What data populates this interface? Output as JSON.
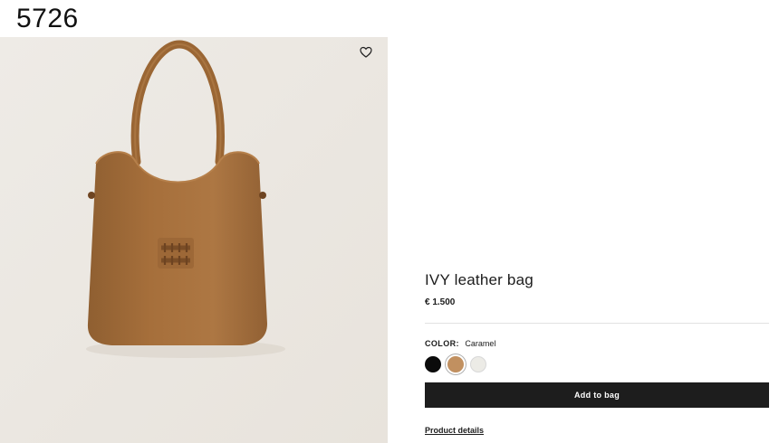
{
  "page_number": "5726",
  "image": {
    "background": "#ece8e2",
    "bag_color": "#a8733f",
    "wishlist_icon": "heart-icon"
  },
  "product": {
    "title": "IVY leather bag",
    "price": "€ 1.500",
    "color_label": "COLOR:",
    "color_value": "Caramel",
    "swatches": [
      {
        "name": "Black",
        "hex": "#0b0b0b",
        "selected": false
      },
      {
        "name": "Caramel",
        "hex": "#c19060",
        "selected": true
      },
      {
        "name": "White",
        "hex": "#ecebe6",
        "selected": false
      }
    ],
    "add_to_bag_label": "Add to bag",
    "details_link": "Product details"
  }
}
